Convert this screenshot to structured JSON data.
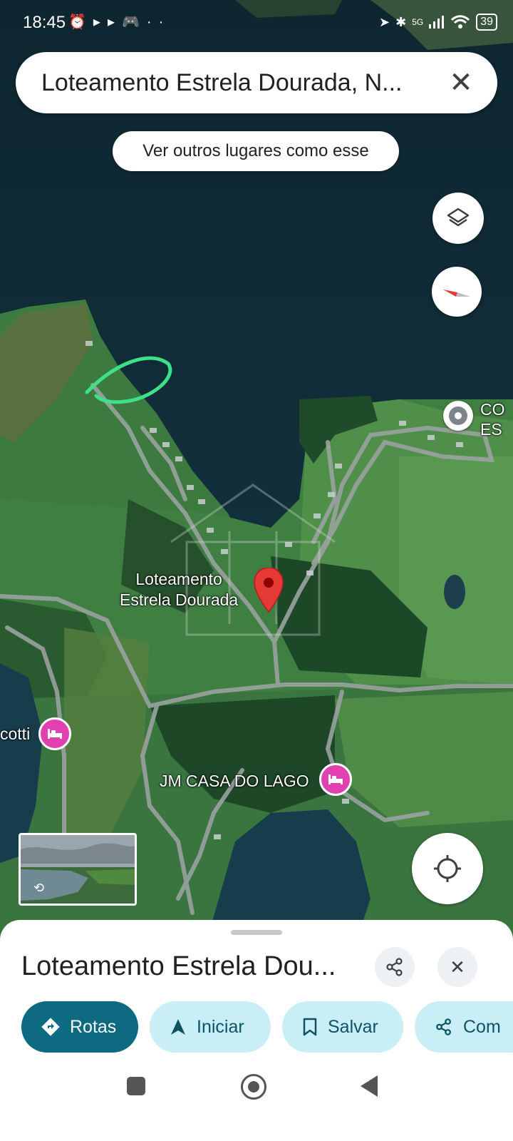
{
  "status_bar": {
    "time": "18:45",
    "left_icons": [
      "alarm-icon",
      "play-icon",
      "play-icon",
      "gamepad-icon",
      "more-dots"
    ],
    "network": "5G",
    "battery": "39"
  },
  "search": {
    "query": "Loteamento Estrela Dourada, N..."
  },
  "similar_places_chip": "Ver outros lugares como esse",
  "map": {
    "pin_label_line1": "Loteamento",
    "pin_label_line2": "Estrela Dourada",
    "poi_right_line1": "CO",
    "poi_right_line2": "ES",
    "hotel_left": "cotti",
    "hotel_jm": "JM CASA DO LAGO",
    "colors": {
      "water": "#12303d",
      "vegetation": "#2f6b3c",
      "field": "#4c8a45",
      "road": "#9aa2a0",
      "annotation": "#3ee08a",
      "pin": "#e53935",
      "hotel": "#e040b0"
    }
  },
  "bottom_sheet": {
    "title": "Loteamento Estrela Dou...",
    "actions": [
      {
        "label": "Rotas",
        "icon": "directions-icon"
      },
      {
        "label": "Iniciar",
        "icon": "navigation-arrow-icon"
      },
      {
        "label": "Salvar",
        "icon": "bookmark-icon"
      },
      {
        "label": "Com",
        "icon": "share-icon"
      }
    ]
  },
  "nav_bar": {
    "buttons": [
      "recents-button",
      "home-button",
      "back-button"
    ]
  }
}
